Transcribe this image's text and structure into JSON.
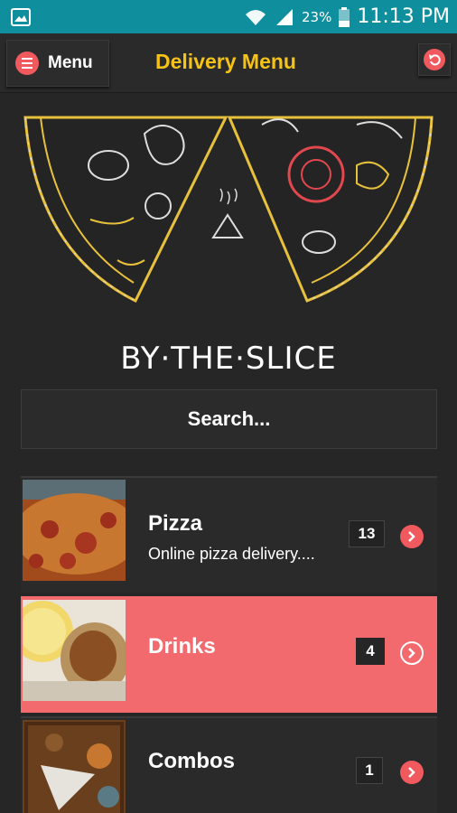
{
  "status_bar": {
    "battery_percent": "23%",
    "time": "11:13 PM",
    "icons": [
      "image-icon",
      "wifi-icon",
      "signal-icon",
      "battery-icon"
    ]
  },
  "app_bar": {
    "menu_label": "Menu",
    "title": "Delivery Menu",
    "accent_color": "#f5c318",
    "button_color": "#f05a5e"
  },
  "banner": {
    "logo_text": "BY·THE·SLICE"
  },
  "search": {
    "placeholder": "Search..."
  },
  "categories": [
    {
      "title": "Pizza",
      "description": "Online pizza delivery....",
      "count": "13",
      "selected": false
    },
    {
      "title": "Drinks",
      "description": "",
      "count": "4",
      "selected": true
    },
    {
      "title": "Combos",
      "description": "",
      "count": "1",
      "selected": false
    }
  ],
  "colors": {
    "selected_row": "#f26a6e",
    "background": "#262626",
    "status_bar": "#0f8f9e"
  }
}
